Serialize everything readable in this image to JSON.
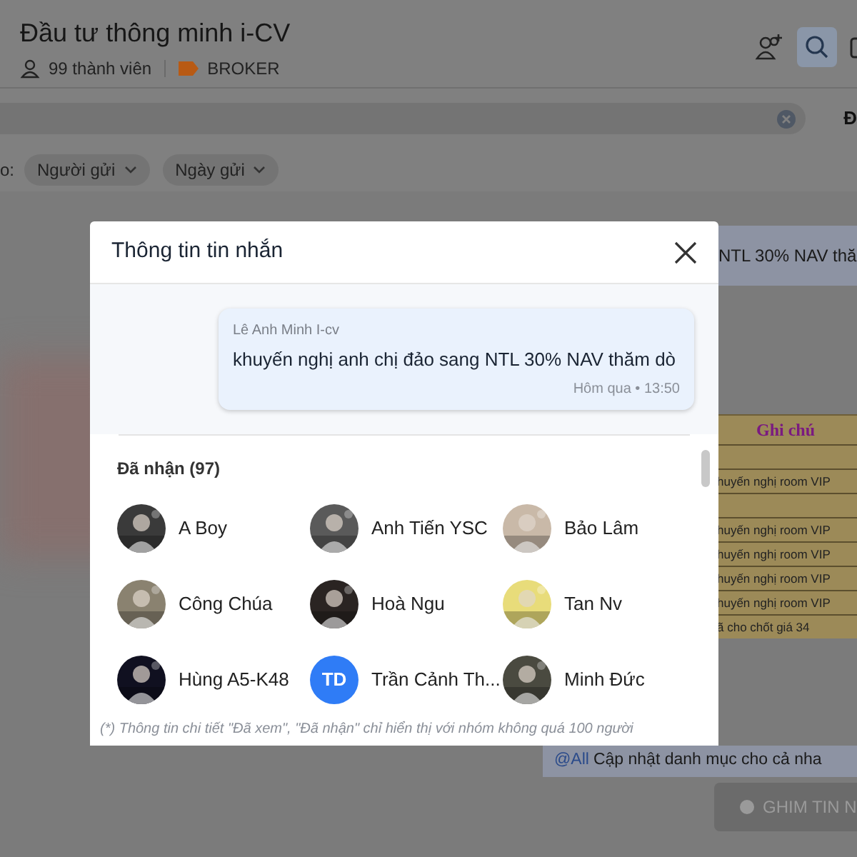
{
  "header": {
    "title": "Đầu tư thông minh i-CV",
    "members": "99 thành viên",
    "tag": "BROKER"
  },
  "search": {
    "side_text": "Đ"
  },
  "filters": {
    "label": "o:",
    "chips": [
      {
        "label": "Người gửi"
      },
      {
        "label": "Ngày gửi"
      }
    ]
  },
  "chat": {
    "bubble_text": "NTL 30% NAV thă",
    "note_table": {
      "heading": "Ghi chú",
      "rows": [
        "",
        "huyến nghị room VIP",
        "",
        "huyến nghị room VIP",
        "huyến nghị room VIP",
        "huyến nghị room VIP",
        "huyến nghị room VIP",
        "ã cho chốt giá 34"
      ]
    },
    "mention": "@All",
    "mention_text": "Cập nhật danh mục cho cả nha",
    "pin_button": "GHIM TIN N"
  },
  "dialog": {
    "title": "Thông tin tin nhắn",
    "message": {
      "sender": "Lê Anh Minh I-cv",
      "text": "khuyến nghị anh chị đảo sang NTL 30% NAV thăm dò",
      "time": "Hôm qua • 13:50"
    },
    "received_heading": "Đã nhận (97)",
    "members": [
      {
        "name": "A Boy"
      },
      {
        "name": "Anh Tiến YSC"
      },
      {
        "name": "Bảo Lâm"
      },
      {
        "name": "Công Chúa"
      },
      {
        "name": "Hoà Ngu"
      },
      {
        "name": "Tan Nv"
      },
      {
        "name": "Hùng A5-K48"
      },
      {
        "name": "Trần Cảnh Th...",
        "kind": "initials",
        "initials": "TD"
      },
      {
        "name": "Minh Đức"
      }
    ],
    "footnote": "(*) Thông tin chi tiết \"Đã xem\", \"Đã nhận\" chỉ hiển thị với nhóm không quá 100 người"
  }
}
